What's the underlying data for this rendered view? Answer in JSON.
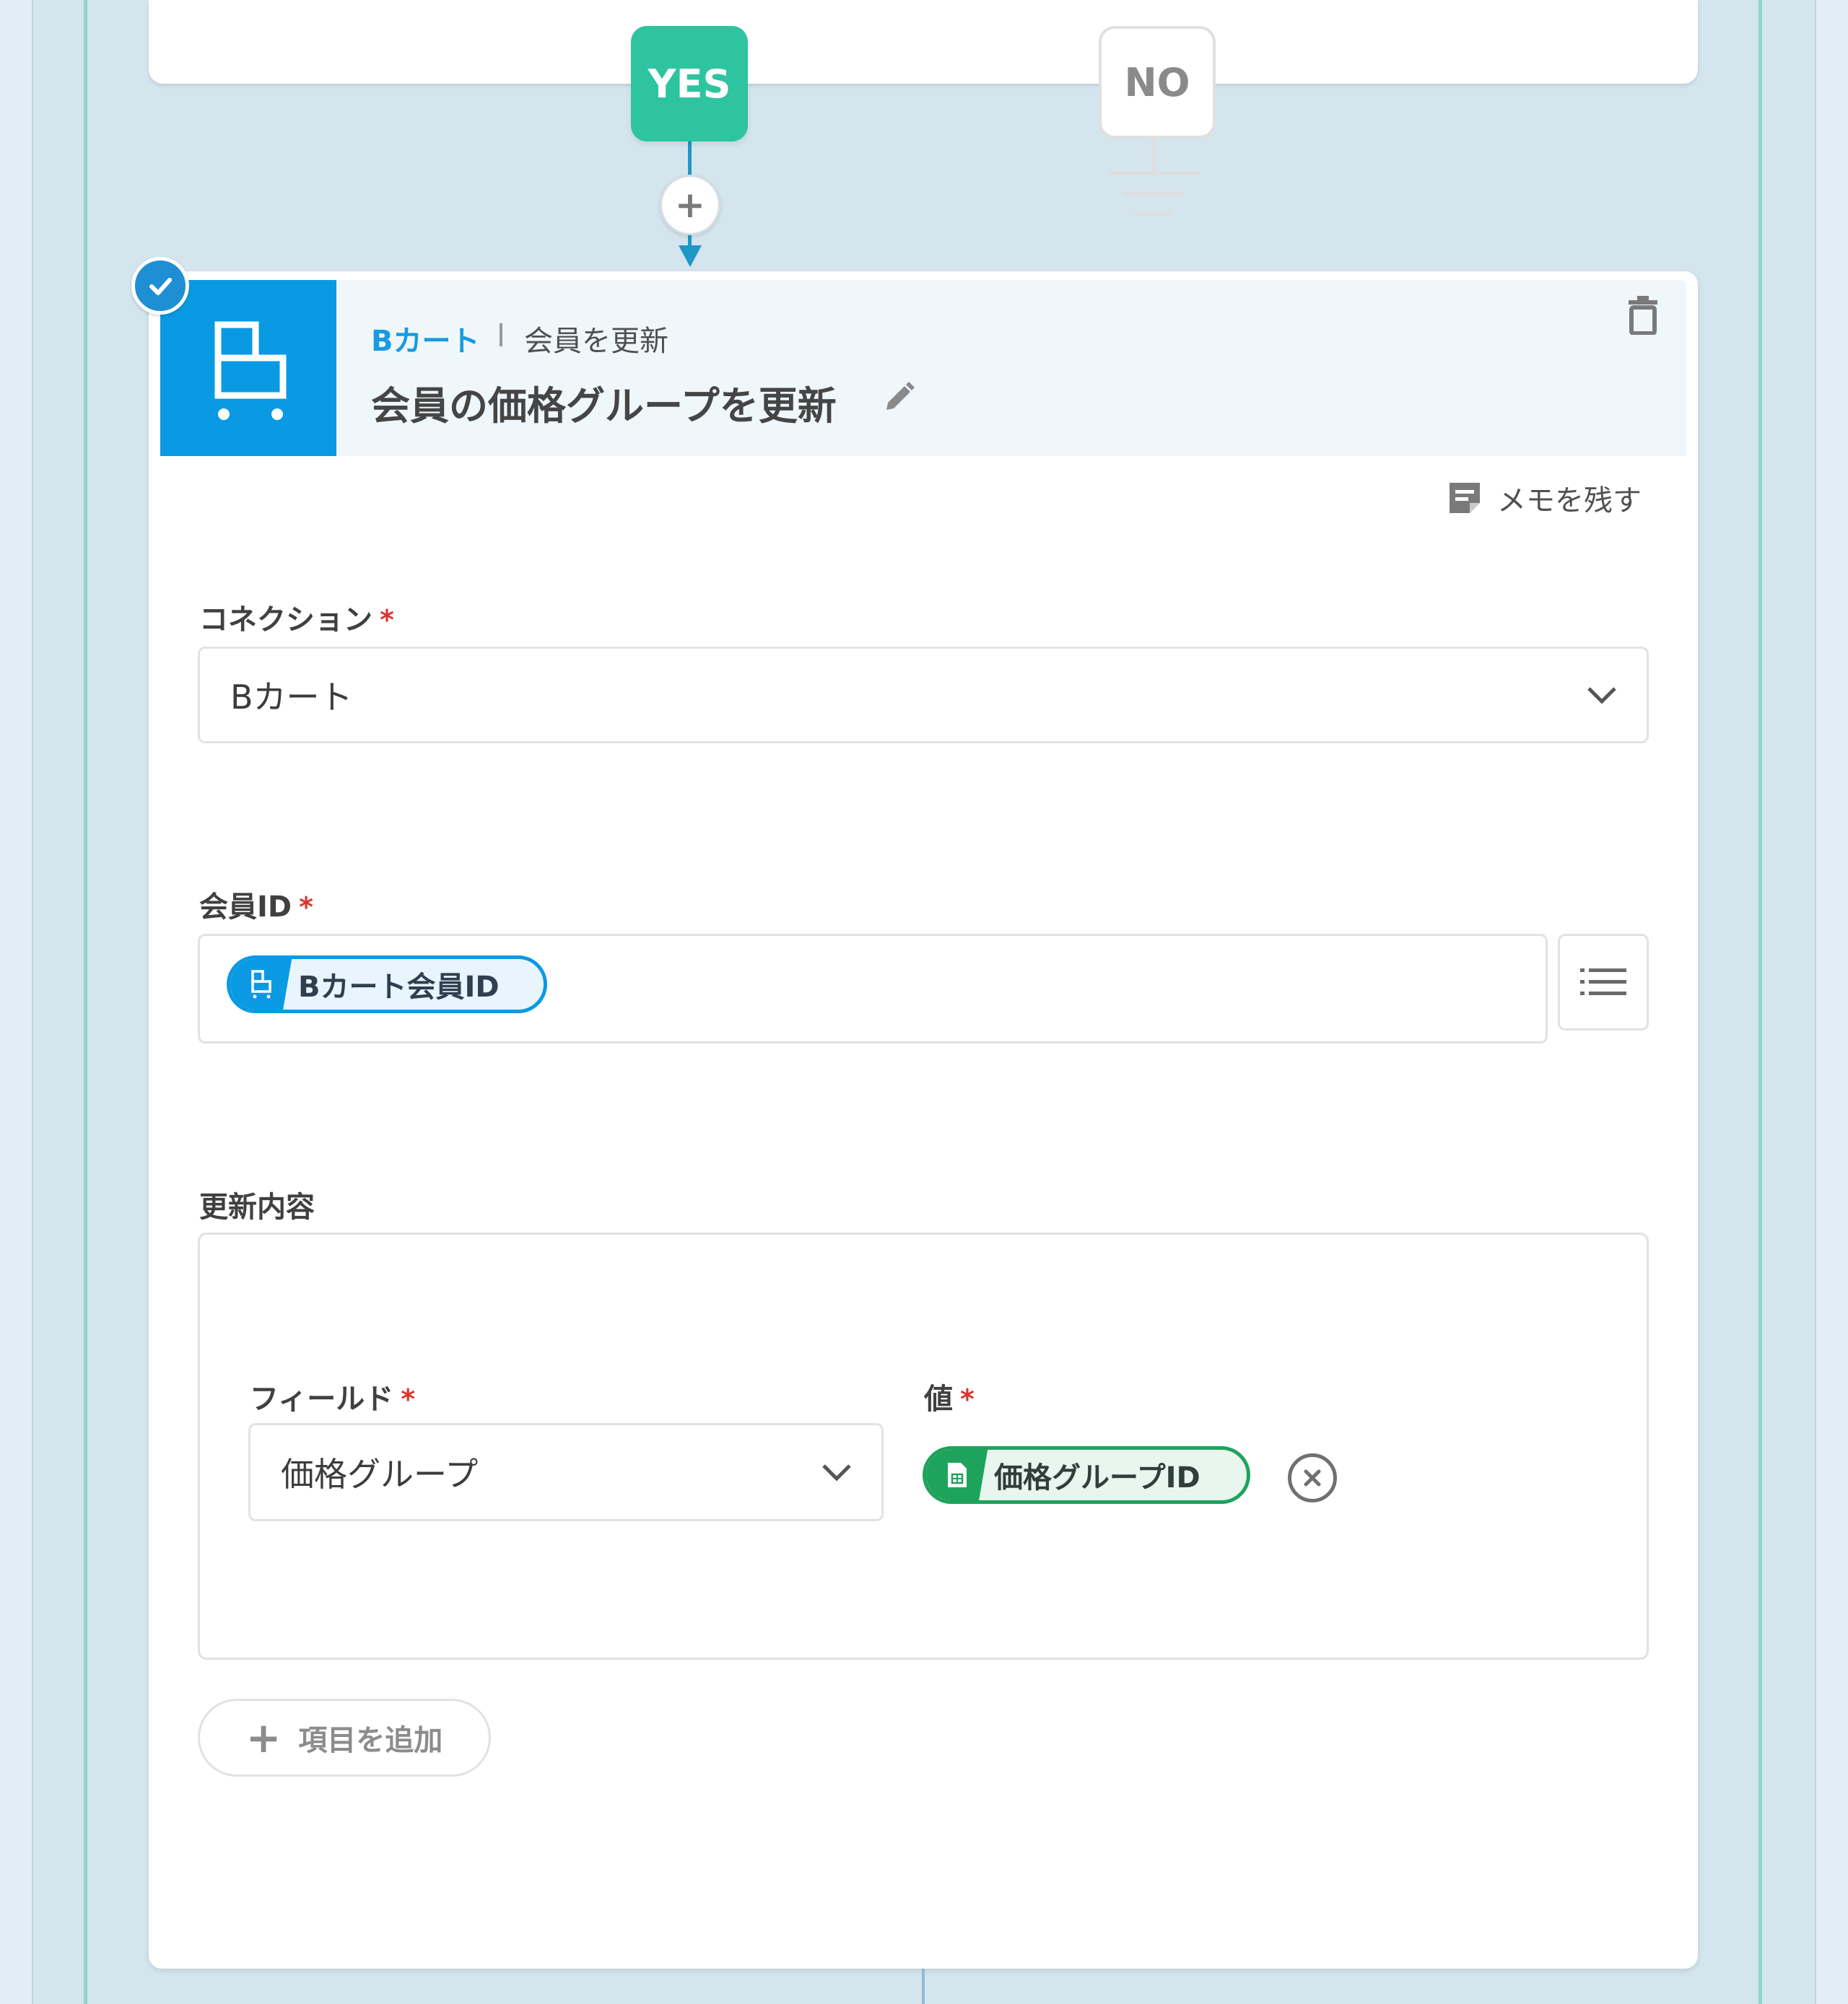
{
  "branch": {
    "yes_label": "YES",
    "no_label": "NO",
    "add_step_symbol": "+"
  },
  "step": {
    "app_name": "Bカート",
    "action_name": "会員を更新",
    "title": "会員の価格グループを更新",
    "status": "completed",
    "icons": {
      "app": "cart-icon",
      "status": "check-icon",
      "edit": "pencil-icon",
      "delete": "trash-icon"
    },
    "colors": {
      "app_accent": "#0a9ae3",
      "yes": "#2ec4a0",
      "sheet_accent": "#1ea35c",
      "required": "#d9352f"
    }
  },
  "memo": {
    "label": "メモを残す",
    "icon": "note-icon"
  },
  "form": {
    "required_mark": "*",
    "connection": {
      "label": "コネクション",
      "value": "Bカート"
    },
    "member_id": {
      "label": "会員ID",
      "pill_label": "Bカート会員ID",
      "pill_icon": "cart-icon",
      "list_icon": "list-icon"
    },
    "update_contents": {
      "label": "更新内容",
      "field_label": "フィールド",
      "field_value": "価格グループ",
      "value_label": "値",
      "value_pill_label": "価格グループID",
      "value_pill_icon": "spreadsheet-icon"
    },
    "add_item": {
      "symbol": "+",
      "label": "項目を追加"
    }
  }
}
